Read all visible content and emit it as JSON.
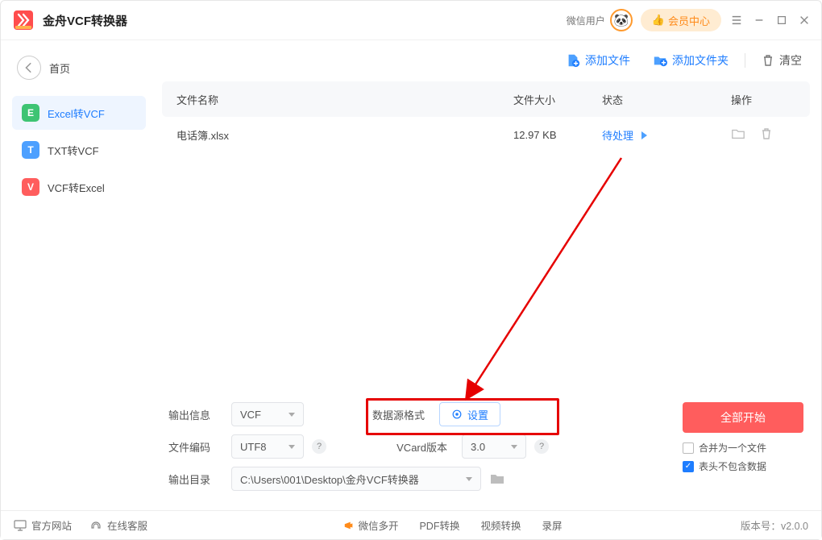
{
  "app": {
    "title": "金舟VCF转换器",
    "wx_label": "微信用户",
    "member_label": "会员中心"
  },
  "sidebar": {
    "home": "首页",
    "items": [
      {
        "badge": "E",
        "label": "Excel转VCF"
      },
      {
        "badge": "T",
        "label": "TXT转VCF"
      },
      {
        "badge": "V",
        "label": "VCF转Excel"
      }
    ]
  },
  "toolbar": {
    "add_file": "添加文件",
    "add_folder": "添加文件夹",
    "clear": "清空"
  },
  "table": {
    "cols": {
      "name": "文件名称",
      "size": "文件大小",
      "state": "状态",
      "op": "操作"
    },
    "rows": [
      {
        "name": "电话簿.xlsx",
        "size": "12.97 KB",
        "state": "待处理"
      }
    ]
  },
  "panel": {
    "out_info_label": "输出信息",
    "out_info_value": "VCF",
    "src_fmt_label": "数据源格式",
    "set_btn": "设置",
    "enc_label": "文件编码",
    "enc_value": "UTF8",
    "vcard_label": "VCard版本",
    "vcard_value": "3.0",
    "out_dir_label": "输出目录",
    "out_dir_value": "C:\\Users\\001\\Desktop\\金舟VCF转换器",
    "start_all": "全部开始",
    "merge_label": "合并为一个文件",
    "hdr_skip_label": "表头不包含数据"
  },
  "footer": {
    "site": "官方网站",
    "support": "在线客服",
    "center": [
      "微信多开",
      "PDF转换",
      "视频转换",
      "录屏"
    ],
    "version_label": "版本号：",
    "version": "v2.0.0"
  }
}
